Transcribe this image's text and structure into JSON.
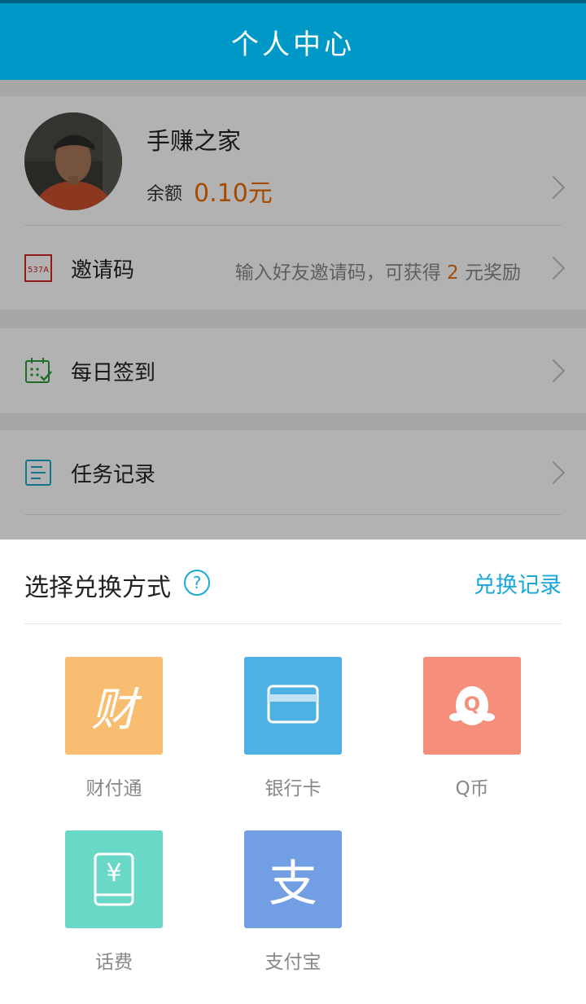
{
  "header": {
    "title": "个人中心"
  },
  "profile": {
    "username": "手赚之家",
    "balance_label": "余额",
    "balance_value": "0.10元"
  },
  "invite": {
    "icon_text": "537A",
    "label": "邀请码",
    "hint_prefix": "输入好友邀请码，可获得 ",
    "hint_amount": "2",
    "hint_suffix": " 元奖励"
  },
  "menu": {
    "daily_signin": "每日签到",
    "task_records": "任务记录"
  },
  "sheet": {
    "title": "选择兑换方式",
    "help_symbol": "?",
    "history_link": "兑换记录",
    "options": [
      {
        "label": "财付通",
        "glyph": "财",
        "color": "#f9bd71"
      },
      {
        "label": "银行卡",
        "color": "#4db1e3"
      },
      {
        "label": "Q币",
        "glyph": "Q",
        "color": "#f58f7c"
      },
      {
        "label": "话费",
        "glyph": "¥",
        "color": "#6ad8c7"
      },
      {
        "label": "支付宝",
        "glyph": "支",
        "color": "#729fe3"
      }
    ]
  },
  "colors": {
    "header": "#0098c7",
    "accent": "#ee6a00",
    "link": "#1aa8dc"
  }
}
